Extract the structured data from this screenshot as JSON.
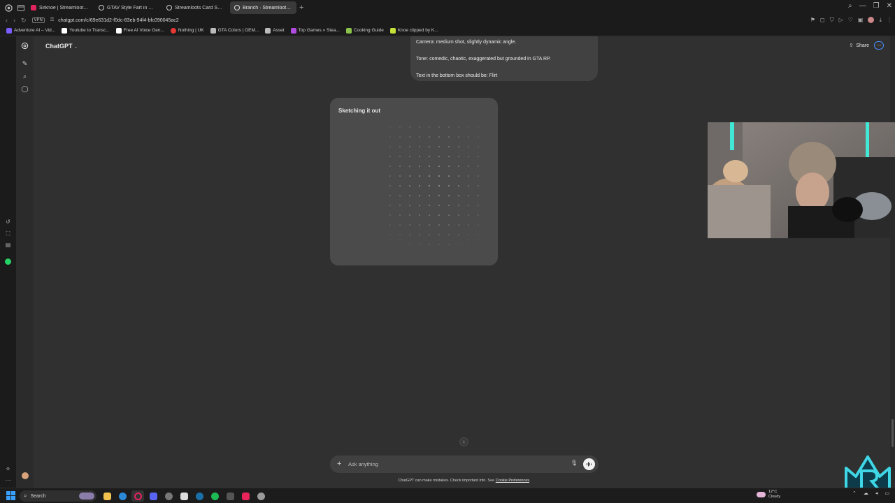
{
  "browser": {
    "tabs": [
      {
        "label": "Sirknoe | Streamloots | Ha",
        "color": "#e0245e",
        "active": false
      },
      {
        "label": "GTAV Style Fart in City Gr",
        "color": "#dddddd",
        "active": false
      },
      {
        "label": "Streamloots Card Setup",
        "color": "#dddddd",
        "active": false
      },
      {
        "label": "Branch · Streamloots Card",
        "color": "#dddddd",
        "active": true
      }
    ],
    "vpn_label": "VPN",
    "url": "chatgpt.com/c/69e631d2-f0dc-83eb-94f4-bfc090045ac2",
    "bookmarks": [
      {
        "label": "Adventure AI – Vid...",
        "color": "#7b5cff"
      },
      {
        "label": "Youtube to Transc...",
        "color": "#ffffff"
      },
      {
        "label": "Free AI Voice Gen...",
        "color": "#ffffff"
      },
      {
        "label": "Nothing | UK",
        "color": "#e53935"
      },
      {
        "label": "GTA Colors | OEM...",
        "color": "#bbbbbb"
      },
      {
        "label": "Asset",
        "color": "#bbbbbb"
      },
      {
        "label": "Top Games » Stea...",
        "color": "#b04de0"
      },
      {
        "label": "Cooking Guide",
        "color": "#8bc34a"
      },
      {
        "label": "Knoe clipped by K...",
        "color": "#c6e03a"
      }
    ]
  },
  "chatgpt": {
    "model_label": "ChatGPT",
    "share_label": "Share",
    "user_message": [
      "Camera: medium shot, slightly dynamic angle.",
      "Tone: comedic, chaotic, exaggerated but grounded in GTA RP.",
      "Text in the bottom box should be: Flirt"
    ],
    "image_status": "Sketching it out",
    "composer_placeholder": "Ask anything",
    "disclaimer_text": "ChatGPT can make mistakes. Check important info. See",
    "disclaimer_link": "Cookie Preferences",
    "disclaimer_end": "."
  },
  "taskbar": {
    "search_label": "Search",
    "weather_temp": "12°C",
    "weather_desc": "Cloudy"
  },
  "colors": {
    "accent_blue": "#4a8df6",
    "main_bg": "#303030",
    "sidebar_bg": "#2b2b2b"
  }
}
